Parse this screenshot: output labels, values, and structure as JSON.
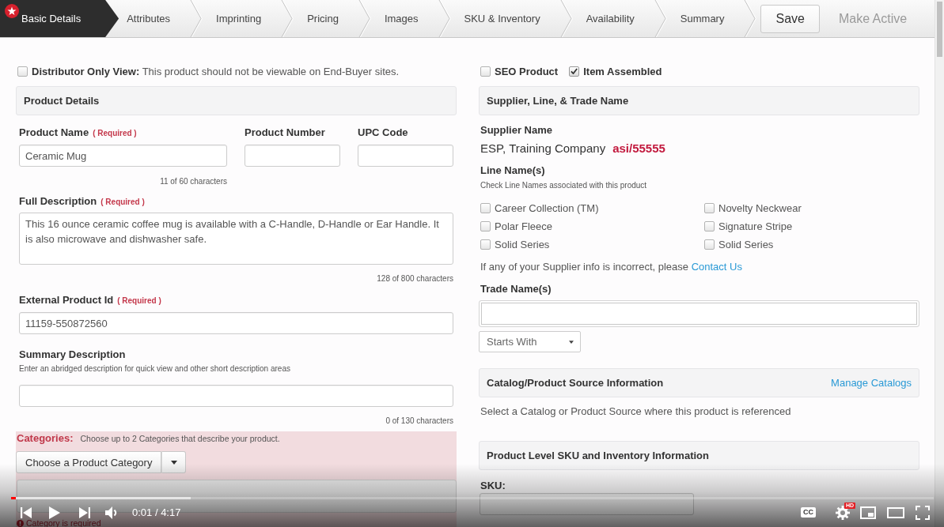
{
  "steps": [
    {
      "label": "Basic Details",
      "selected": true
    },
    {
      "label": "Attributes",
      "selected": false
    },
    {
      "label": "Imprinting",
      "selected": false
    },
    {
      "label": "Pricing",
      "selected": false
    },
    {
      "label": "Images",
      "selected": false
    },
    {
      "label": "SKU & Inventory",
      "selected": false
    },
    {
      "label": "Availability",
      "selected": false
    },
    {
      "label": "Summary",
      "selected": false
    }
  ],
  "actions": [
    {
      "label": "Save",
      "disabled": false
    },
    {
      "label": "Make Active",
      "disabled": true
    }
  ],
  "distributor_only": {
    "text": "**Distributor Only View:** This product should not be viewable on End-Buyer sites.",
    "checked": false
  },
  "product_details": {
    "title": "Product Details",
    "fields": [
      {
        "label": "Product Name",
        "required": "( Required )",
        "value": "Ceramic Mug",
        "counter": "11 of 60 characters"
      },
      {
        "label": "Product Number"
      },
      {
        "label": "UPC Code"
      }
    ],
    "full_description": {
      "label": "Full Description",
      "required": "( Required )",
      "value": "This 16 ounce ceramic coffee mug is available with a C-Handle, D-Handle or Ear Handle. It is also microwave and dishwasher safe.",
      "counter": "128 of 800 characters"
    },
    "external_id": {
      "label": "External Product Id",
      "required": "( Required )",
      "value": "11159-550872560"
    },
    "summary": {
      "label": "Summary Description",
      "hint": "Enter an abridged description for quick view and other short description areas",
      "counter": "0 of 130 characters"
    }
  },
  "categories": {
    "label": "Categories:",
    "hint": "Choose up to 2 Categories that describe your product.",
    "dropdown": "Choose a Product Category",
    "error": "Category is required"
  },
  "flags": [
    {
      "label": "SEO Product",
      "checked": false
    },
    {
      "label": "Item Assembled",
      "checked": true
    }
  ],
  "supplier": {
    "title": "Supplier, Line, & Trade Name",
    "name_label": "Supplier Name",
    "name": "ESP, Training Company",
    "asi_number": "asi/55555",
    "lines_label": "Line Name(s)",
    "lines_hint": "Check Line Names associated with this product",
    "lines": [
      {
        "label": "Career Collection (TM)",
        "checked": false
      },
      {
        "label": "Polar Fleece",
        "checked": false
      },
      {
        "label": "Solid Series",
        "checked": false
      },
      {
        "label": "Novelty Neckwear",
        "checked": false
      },
      {
        "label": "Signature Stripe",
        "checked": false
      },
      {
        "label": "Solid Series",
        "checked": false
      }
    ],
    "contact_note": "If any of your Supplier info is incorrect, please",
    "contact_link": "Contact Us",
    "trade_label": "Trade Name(s)",
    "trade_match": "Starts With"
  },
  "catalog": {
    "title": "Catalog/Product Source Information",
    "link": "Manage Catalogs",
    "note": "Select a Catalog or Product Source where this product is referenced"
  },
  "sku": {
    "title": "Product Level SKU and Inventory Information",
    "label": "SKU:"
  },
  "player": {
    "buffer": {
      "level": 0.195
    },
    "progress": {
      "level": 0.005
    },
    "time": "0:01 / 4:17",
    "captions": "CC",
    "quality": "HD"
  }
}
